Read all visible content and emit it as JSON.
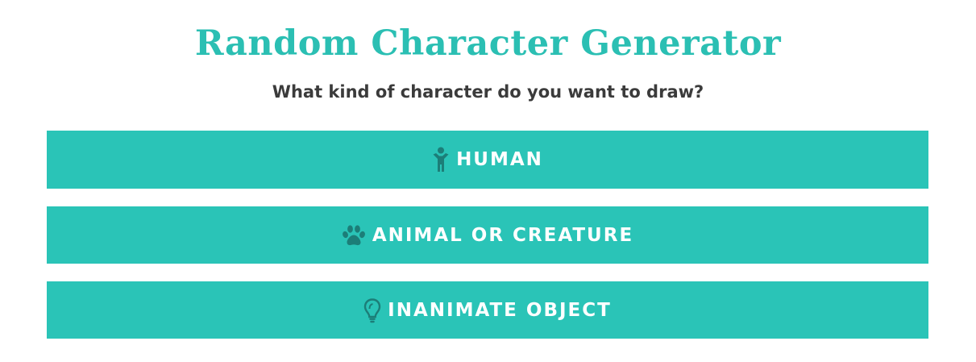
{
  "header": {
    "title": "Random Character Generator",
    "subtitle": "What kind of character do you want to draw?"
  },
  "options": [
    {
      "label": "HUMAN",
      "icon": "child-icon"
    },
    {
      "label": "ANIMAL OR CREATURE",
      "icon": "paw-icon"
    },
    {
      "label": "INANIMATE OBJECT",
      "icon": "lightbulb-icon"
    }
  ],
  "colors": {
    "accent": "#2ac4b7",
    "title": "#2bbfb3",
    "icon": "#1c7e78",
    "button_text": "#ffffff",
    "subtitle_text": "#3b3b3b"
  }
}
